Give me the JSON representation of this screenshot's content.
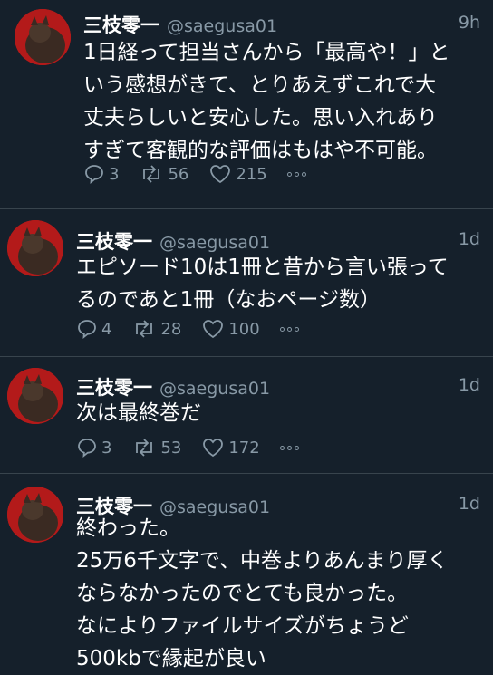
{
  "tweets": [
    {
      "name": "三枝零一",
      "handle": "@saegusa01",
      "time": "9h",
      "text": "1日経って担当さんから「最高や！」と\nいう感想がきて、とりあえずこれで大\n丈夫らしいと安心した。思い入れあり\nすぎて客観的な評価はもはや不可能。",
      "replies": "3",
      "retweets": "56",
      "likes": "215"
    },
    {
      "name": "三枝零一",
      "handle": "@saegusa01",
      "time": "1d",
      "text": "エピソード10は1冊と昔から言い張って\nるのであと1冊（なおページ数）",
      "replies": "4",
      "retweets": "28",
      "likes": "100"
    },
    {
      "name": "三枝零一",
      "handle": "@saegusa01",
      "time": "1d",
      "text": "次は最終巻だ",
      "replies": "3",
      "retweets": "53",
      "likes": "172"
    },
    {
      "name": "三枝零一",
      "handle": "@saegusa01",
      "time": "1d",
      "text": "終わった。\n25万6千文字で、中巻よりあんまり厚く\nならなかったのでとても良かった。\nなによりファイルサイズがちょうど\n500kbで縁起が良い"
    }
  ],
  "icons": {
    "reply": "reply-icon",
    "retweet": "retweet-icon",
    "like": "heart-icon",
    "more": "more-icon"
  },
  "colors": {
    "background": "#15202b",
    "secondary_text": "#8899a6",
    "divider": "#38444d"
  }
}
